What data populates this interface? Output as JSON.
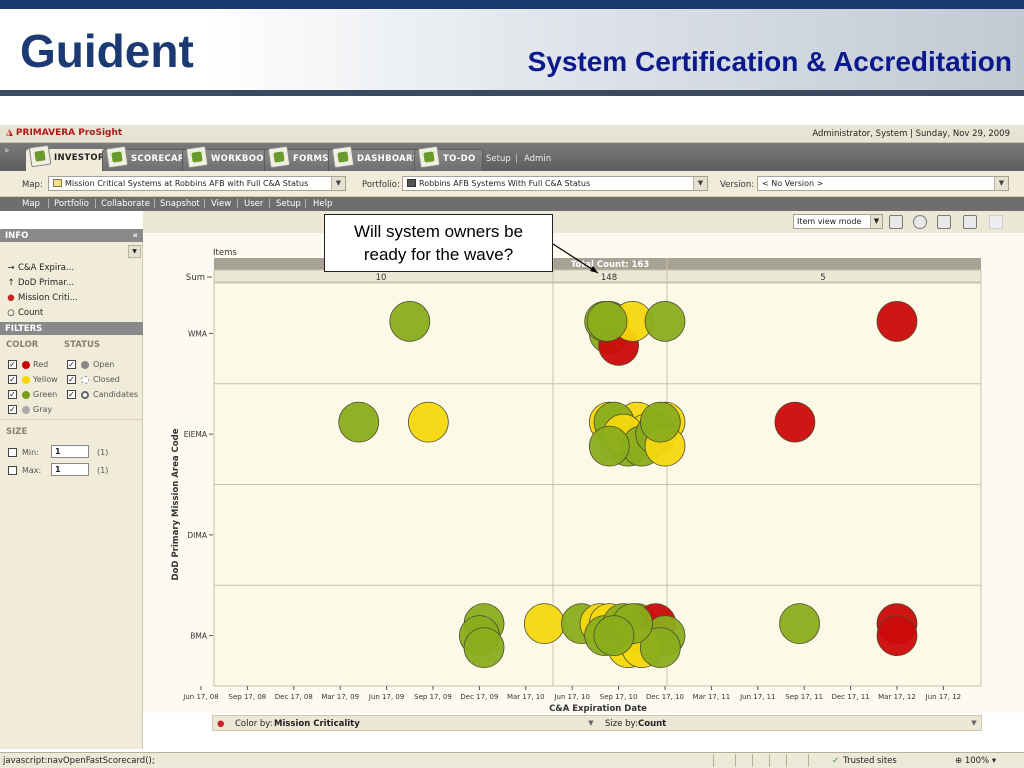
{
  "slide": {
    "logo": "Guident",
    "title": "System Certification & Accreditation"
  },
  "app": {
    "brand": "PRIMAVERA ProSight",
    "user_info": "Administrator, System | Sunday, Nov 29, 2009",
    "collapse": "»",
    "tabs": [
      {
        "label": "INVESTOR",
        "active": true
      },
      {
        "label": "SCORECARD"
      },
      {
        "label": "WORKBOOK"
      },
      {
        "label": "FORMS"
      },
      {
        "label": "DASHBOARDS"
      },
      {
        "label": "TO-DO"
      }
    ],
    "setup_link": "Setup",
    "admin_link": "Admin",
    "link_sep": "|",
    "map_label": "Map:",
    "map_value": "Mission Critical Systems at Robbins AFB with Full C&A Status",
    "portfolio_label": "Portfolio:",
    "portfolio_value": "Robbins AFB Systems With Full C&A Status",
    "version_label": "Version:",
    "version_value": "< No Version >",
    "menu": [
      "Map",
      "Portfolio",
      "Collaborate",
      "Snapshot",
      "View",
      "User",
      "Setup",
      "Help"
    ],
    "view_mode": "Item view mode"
  },
  "panel": {
    "info_head": "INFO",
    "info_collapse": "«",
    "info_items": [
      {
        "icon": "→",
        "label": "C&A Expira..."
      },
      {
        "icon": "↑",
        "label": "DoD Primar..."
      },
      {
        "icon": "●",
        "label": "Mission Criti..."
      },
      {
        "icon": "○",
        "label": "Count"
      }
    ],
    "filters_head": "FILTERS",
    "color_head": "COLOR",
    "status_head": "STATUS",
    "colors": [
      {
        "label": "Red",
        "hex": "#cc0000"
      },
      {
        "label": "Yellow",
        "hex": "#f2d800"
      },
      {
        "label": "Green",
        "hex": "#7a9c1a"
      },
      {
        "label": "Gray",
        "hex": "#aaaaaa"
      }
    ],
    "statuses": [
      "Open",
      "Closed",
      "Candidates"
    ],
    "size_head": "SIZE",
    "min_label": "Min:",
    "max_label": "Max:",
    "min_value": "1",
    "max_value": "1",
    "min_count": "(1)",
    "max_count": "(1)",
    "check": "✓"
  },
  "bottom": {
    "color_by_label": "Color by:",
    "color_by_value": "Mission Criticality",
    "size_by_label": "Size by:",
    "size_by_value": "Count"
  },
  "status": {
    "text": "javascript:navOpenFastScorecard();",
    "zone": "Trusted sites",
    "zoom": "100%"
  },
  "callout": {
    "line1": "Will system owners be",
    "line2": "ready for the wave?"
  },
  "chart_data": {
    "type": "scatter",
    "items_label": "Items",
    "total_label": "Total Count: 163",
    "sum_label": "Sum",
    "sums": [
      "10",
      "148",
      "5"
    ],
    "xlabel": "C&A Expiration Date",
    "ylabel": "DoD Primary Mission Area Code",
    "x_ticks": [
      "Jun 17, 08",
      "Sep 17, 08",
      "Dec 17, 08",
      "Mar 17, 09",
      "Jun 17, 09",
      "Sep 17, 09",
      "Dec 17, 09",
      "Mar 17, 10",
      "Jun 17, 10",
      "Sep 17, 10",
      "Dec 17, 10",
      "Mar 17, 11",
      "Jun 17, 11",
      "Sep 17, 11",
      "Dec 17, 11",
      "Mar 17, 12",
      "Jun 17, 12"
    ],
    "y_categories": [
      "WMA",
      "EIEMA",
      "DIMA",
      "BMA"
    ],
    "colors": {
      "green": "#8aad1c",
      "yellow": "#f5d80e",
      "red": "#cc0a0a"
    },
    "points": [
      {
        "x": 4.5,
        "y": "WMA",
        "c": "green"
      },
      {
        "x": 8.8,
        "y": "WMA",
        "c": "green"
      },
      {
        "x": 8.8,
        "y": "WMA",
        "c": "green"
      },
      {
        "x": 9.0,
        "y": "WMA",
        "c": "red"
      },
      {
        "x": 9.3,
        "y": "WMA",
        "c": "yellow"
      },
      {
        "x": 8.7,
        "y": "WMA",
        "c": "green"
      },
      {
        "x": 8.75,
        "y": "WMA",
        "c": "green"
      },
      {
        "x": 10.0,
        "y": "WMA",
        "c": "green"
      },
      {
        "x": 15.0,
        "y": "WMA",
        "c": "red"
      },
      {
        "x": 3.4,
        "y": "EIEMA",
        "c": "green"
      },
      {
        "x": 4.9,
        "y": "EIEMA",
        "c": "yellow"
      },
      {
        "x": 8.8,
        "y": "EIEMA",
        "c": "yellow"
      },
      {
        "x": 9.0,
        "y": "EIEMA",
        "c": "yellow"
      },
      {
        "x": 9.2,
        "y": "EIEMA",
        "c": "green"
      },
      {
        "x": 9.4,
        "y": "EIEMA",
        "c": "yellow"
      },
      {
        "x": 9.6,
        "y": "EIEMA",
        "c": "yellow"
      },
      {
        "x": 10.0,
        "y": "EIEMA",
        "c": "yellow"
      },
      {
        "x": 8.9,
        "y": "EIEMA",
        "c": "green"
      },
      {
        "x": 9.1,
        "y": "EIEMA",
        "c": "yellow"
      },
      {
        "x": 9.5,
        "y": "EIEMA",
        "c": "green"
      },
      {
        "x": 9.8,
        "y": "EIEMA",
        "c": "green"
      },
      {
        "x": 10.0,
        "y": "EIEMA",
        "c": "yellow"
      },
      {
        "x": 8.8,
        "y": "EIEMA",
        "c": "green"
      },
      {
        "x": 9.9,
        "y": "EIEMA",
        "c": "green"
      },
      {
        "x": 12.8,
        "y": "EIEMA",
        "c": "red"
      },
      {
        "x": 6.1,
        "y": "BMA",
        "c": "green"
      },
      {
        "x": 6.0,
        "y": "BMA",
        "c": "green"
      },
      {
        "x": 6.1,
        "y": "BMA",
        "c": "green"
      },
      {
        "x": 7.4,
        "y": "BMA",
        "c": "yellow"
      },
      {
        "x": 8.2,
        "y": "BMA",
        "c": "green"
      },
      {
        "x": 8.6,
        "y": "BMA",
        "c": "yellow"
      },
      {
        "x": 8.8,
        "y": "BMA",
        "c": "yellow"
      },
      {
        "x": 9.0,
        "y": "BMA",
        "c": "green"
      },
      {
        "x": 9.2,
        "y": "BMA",
        "c": "yellow"
      },
      {
        "x": 9.4,
        "y": "BMA",
        "c": "green"
      },
      {
        "x": 9.6,
        "y": "BMA",
        "c": "green"
      },
      {
        "x": 9.8,
        "y": "BMA",
        "c": "red"
      },
      {
        "x": 10.0,
        "y": "BMA",
        "c": "green"
      },
      {
        "x": 8.7,
        "y": "BMA",
        "c": "green"
      },
      {
        "x": 9.1,
        "y": "BMA",
        "c": "green"
      },
      {
        "x": 9.5,
        "y": "BMA",
        "c": "yellow"
      },
      {
        "x": 9.9,
        "y": "BMA",
        "c": "green"
      },
      {
        "x": 9.3,
        "y": "BMA",
        "c": "green"
      },
      {
        "x": 8.9,
        "y": "BMA",
        "c": "green"
      },
      {
        "x": 12.9,
        "y": "BMA",
        "c": "green"
      },
      {
        "x": 15.0,
        "y": "BMA",
        "c": "red"
      },
      {
        "x": 15.0,
        "y": "BMA",
        "c": "red"
      }
    ]
  }
}
